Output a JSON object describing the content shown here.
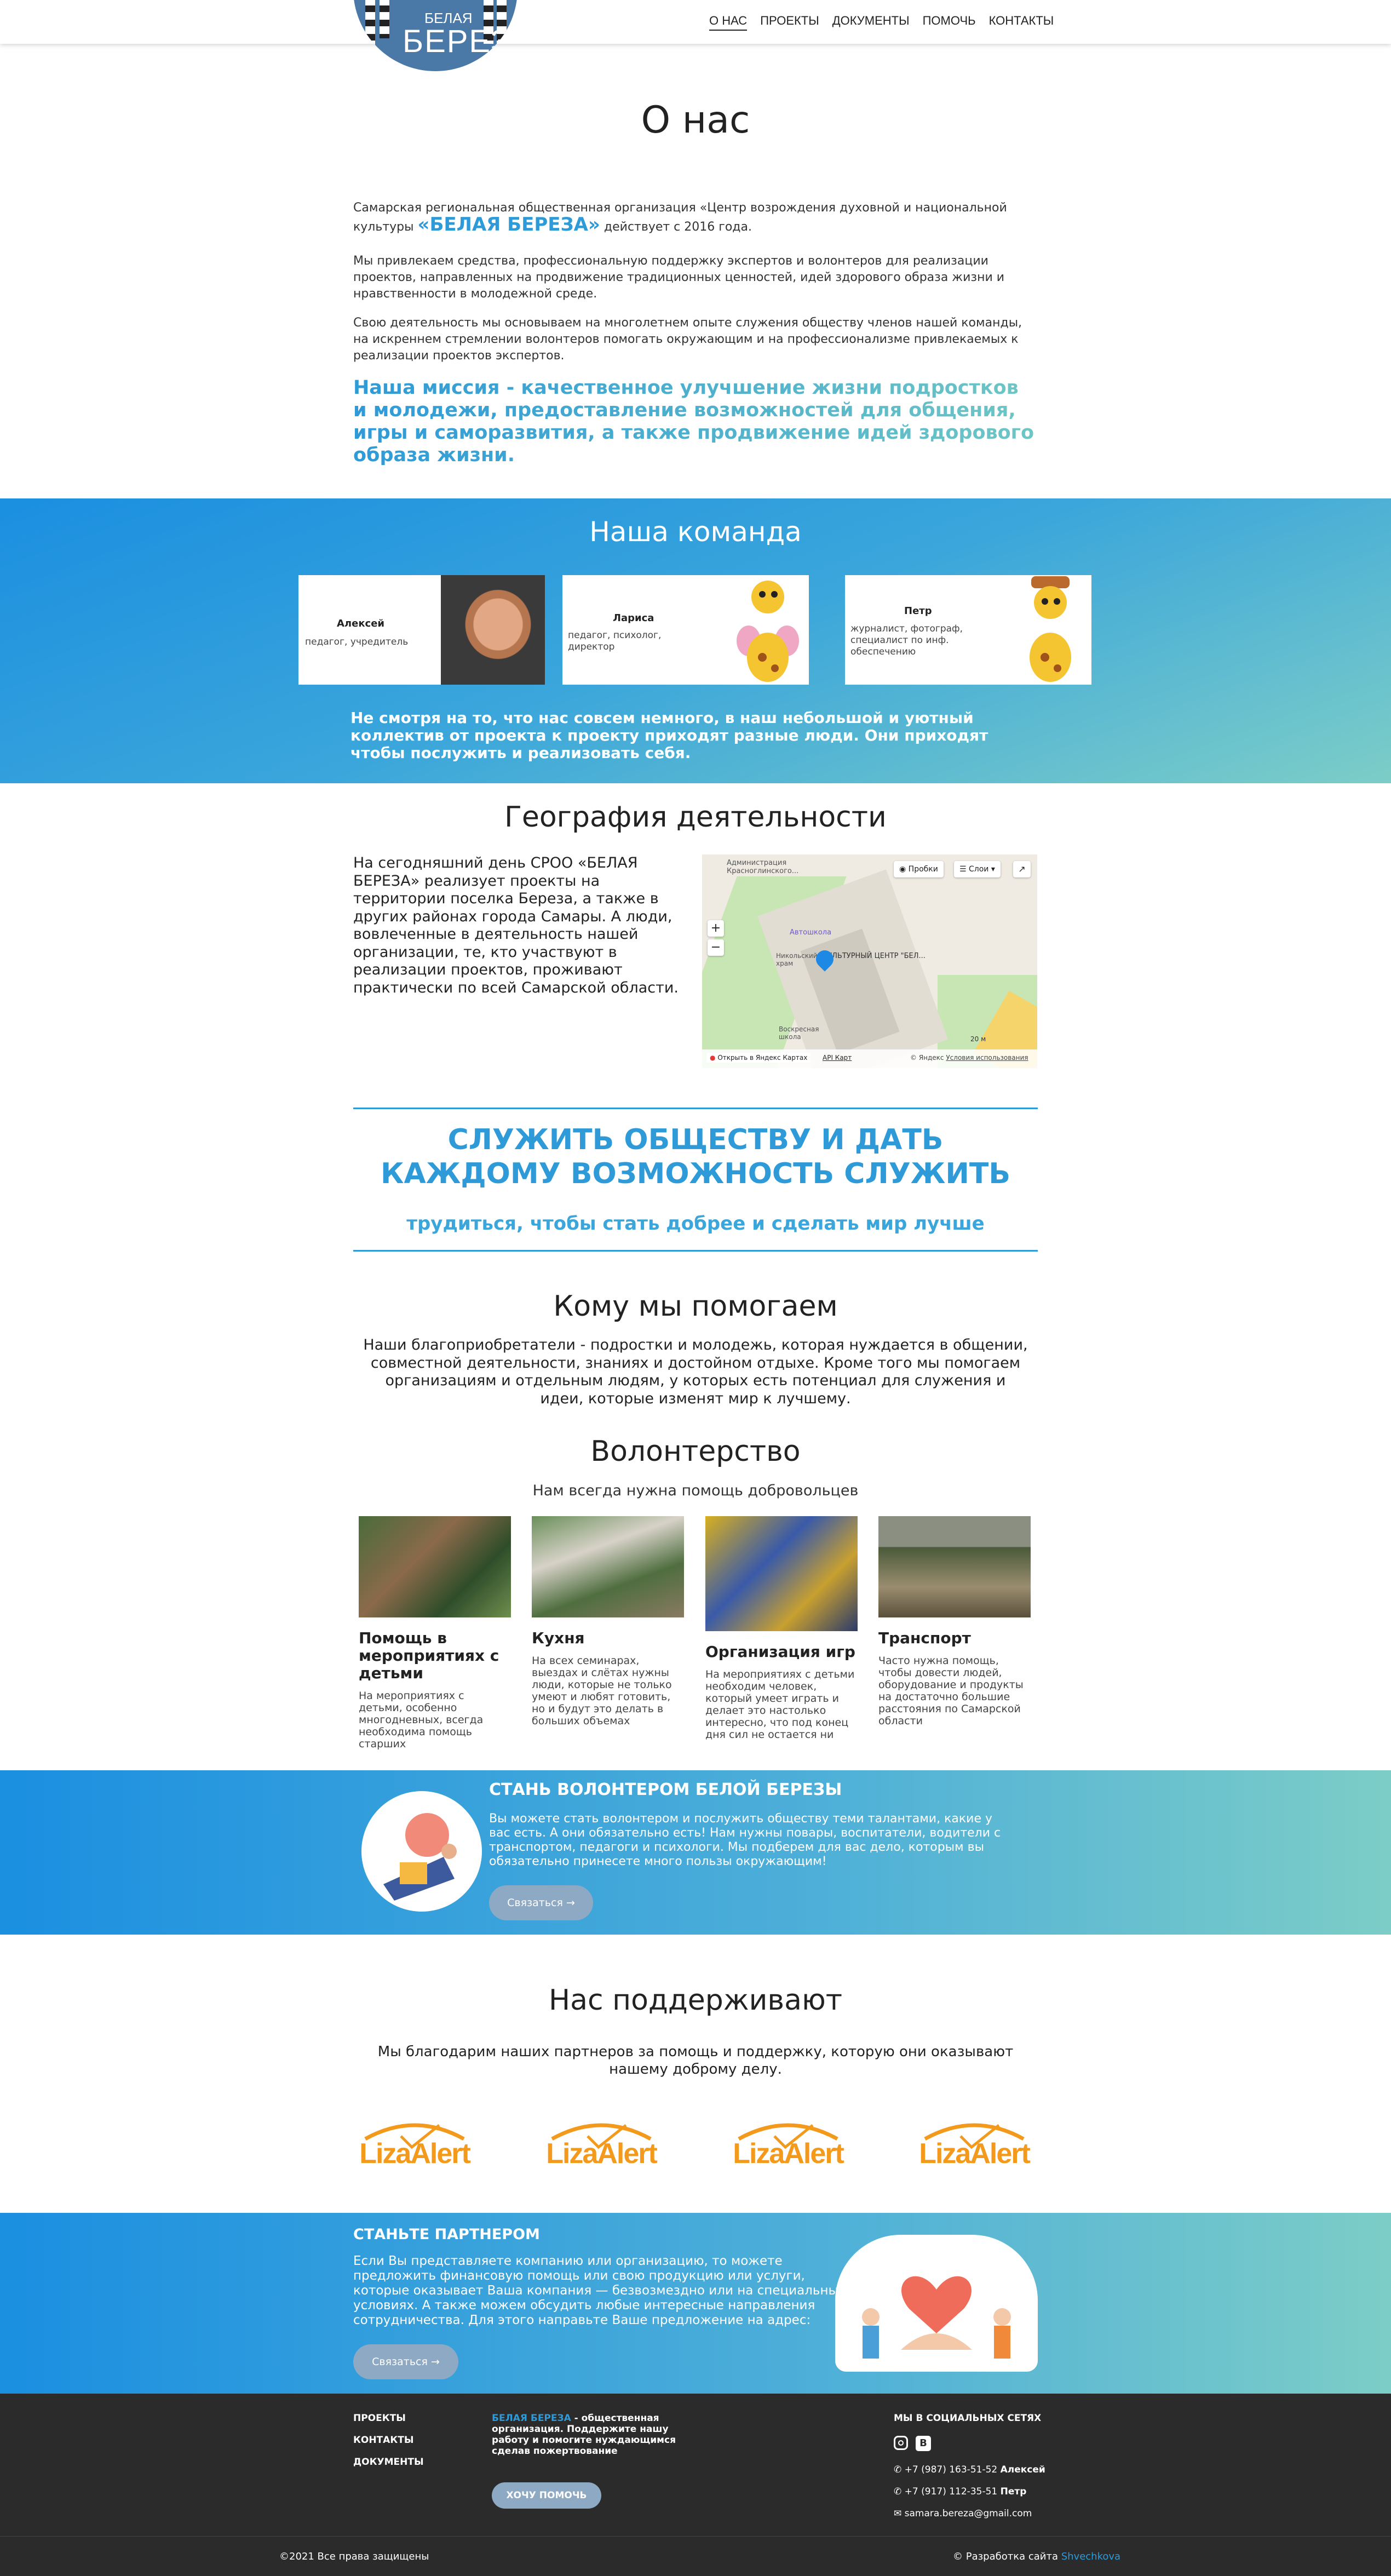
{
  "header": {
    "logo_small": "БЕЛАЯ",
    "logo_big": "БЕРЕЗА",
    "nav": [
      "О НАС",
      "ПРОЕКТЫ",
      "ДОКУМЕНТЫ",
      "ПОМОЧЬ",
      "КОНТАКТЫ"
    ]
  },
  "about": {
    "title": "О нас",
    "p1a": "Самарская региональная общественная организация «Центр возрождения духовной и национальной культуры ",
    "p1b": "«БЕЛАЯ БЕРЕЗА»",
    "p1c": " действует с 2016 года.",
    "p2": "Мы привлекаем средства, профессиональную поддержку экспертов и волонтеров для реализации проектов, направленных на продвижение традиционных ценностей, идей здорового образа жизни и нравственности в молодежной среде.",
    "p3": "Свою деятельность мы основываем на многолетнем опыте служения обществу членов нашей команды, на искреннем стремлении волонтеров помогать окружающим и на профессионализме привлекаемых к реализации проектов экспертов.",
    "mission": "Наша миссия - качественное улучшение жизни подростков и молодежи, предоставление возможностей для общения, игры и саморазвития, а также продвижение идей здорового образа жизни."
  },
  "team": {
    "title": "Наша команда",
    "members": [
      {
        "name": "Алексей",
        "role": "педагог, учредитель"
      },
      {
        "name": "Лариса",
        "role": "педагог, психолог, директор"
      },
      {
        "name": "Петр",
        "role": "журналист, фотограф, специалист по инф. обеспечению"
      }
    ],
    "note": "Не смотря на то, что нас совсем немного, в наш небольшой и уютный коллектив от проекта к проекту приходят разные люди. Они приходят чтобы послужить и реализовать себя."
  },
  "geo": {
    "title": "География деятельности",
    "text": "На сегодняшний день СРОО «БЕЛАЯ БЕРЕЗА» реализует проекты на территории поселка Береза, а также в других районах города Самары. А люди, вовлеченные в деятельность нашей организации, те, кто участвуют в реализации проектов, проживают практически по всей Самарской области.",
    "map": {
      "traffic": "Пробки",
      "layers": "Слои",
      "label_center": "КУЛЬТУРНЫЙ ЦЕНТР \"БЕЛ...",
      "label_admin": "Администрация Красноглинского...",
      "label_bus": "Автошкола",
      "label_church": "Никольский храм",
      "label_school": "Воскресная школа",
      "open": "Открыть в Яндекс Картах",
      "api": "API Карт",
      "copyright": "© Яндекс",
      "terms": "Условия использования",
      "scale": "20 м"
    }
  },
  "slogan": {
    "main": "СЛУЖИТЬ ОБЩЕСТВУ И ДАТЬ КАЖДОМУ ВОЗМОЖНОСТЬ СЛУЖИТЬ",
    "sub": "трудиться, чтобы стать добрее и сделать мир лучше"
  },
  "help": {
    "title": "Кому мы помогаем",
    "text": "Наши благоприобретатели - подростки и молодежь, которая нуждается в общении, совместной деятельности, знаниях и достойном отдыхе. Кроме того мы помогаем организациям и отдельным людям, у которых есть потенциал для служения и идеи, которые изменят мир к лучшему."
  },
  "volunteer": {
    "title": "Волонтерство",
    "subtitle": "Нам всегда нужна помощь добровольцев",
    "items": [
      {
        "title": "Помощь в мероприятиях с детьми",
        "desc": "На мероприятиях с детьми, особенно многодневных, всегда необходима помощь старших"
      },
      {
        "title": "Кухня",
        "desc": "На всех семинарах, выездах и слётах нужны люди, которые не только умеют и любят готовить, но и будут это делать в больших объемах"
      },
      {
        "title": "Организация игр",
        "desc": "На мероприятиях с детьми необходим человек, который умеет играть и делает это настолько интересно, что под конец дня сил не остается ни капельки"
      },
      {
        "title": "Транспорт",
        "desc": "Часто нужна помощь, чтобы довести людей, оборудование и продукты на достаточно большие расстояния по Самарской области"
      }
    ]
  },
  "become": {
    "title": "СТАНЬ ВОЛОНТЕРОМ БЕЛОЙ БЕРЕЗЫ",
    "text": "Вы можете стать волонтером и послужить обществу теми талантами, какие у вас есть. А они обязательно есть! Нам нужны повары, воспитатели, водители с транспортом, педагоги и психологи. Мы подберем для вас дело, которым вы обязательно принесете много пользы окружающим!",
    "button": "Связаться →"
  },
  "support": {
    "title": "Нас поддерживают",
    "text": "Мы благодарим наших партнеров за помощь и поддержку, которую они оказывают нашему доброму делу.",
    "partner": "LizaAlert"
  },
  "partner": {
    "title": "СТАНЬТЕ ПАРТНЕРОМ",
    "text": "Если Вы представляете компанию или организацию, то можете предложить финансовую помощь или свою продукцию или услуги, которые оказывает Ваша компания — безвозмездно или на специальных условиях. А также можем обсудить любые интересные направления сотрудничества. Для этого направьте Ваше предложение на адрес:",
    "button": "Связаться →"
  },
  "footer": {
    "links": [
      "ПРОЕКТЫ",
      "КОНТАКТЫ",
      "ДОКУМЕНТЫ"
    ],
    "brand": "БЕЛАЯ БЕРЕЗА",
    "about": " - общественная организация. Поддержите нашу работу и помогите нуждающимся сделав пожертвование",
    "donate": "ХОЧУ ПОМОЧЬ",
    "social_title": "МЫ В СОЦИАЛЬНЫХ СЕТЯХ",
    "phone1": "+7 (987) 163-51-52",
    "phone1_name": "Алексей",
    "phone2": "+7 (917) 112-35-51",
    "phone2_name": "Петр",
    "email": "samara.bereza@gmail.com",
    "copyright": "©2021 Все права защищены",
    "dev": "© Разработка сайта ",
    "dev_link": "Shvechkova"
  },
  "colors": {
    "accent": "#2e9ad8",
    "footer_bg": "#2b2b2b",
    "liza": "#f39a1c"
  }
}
